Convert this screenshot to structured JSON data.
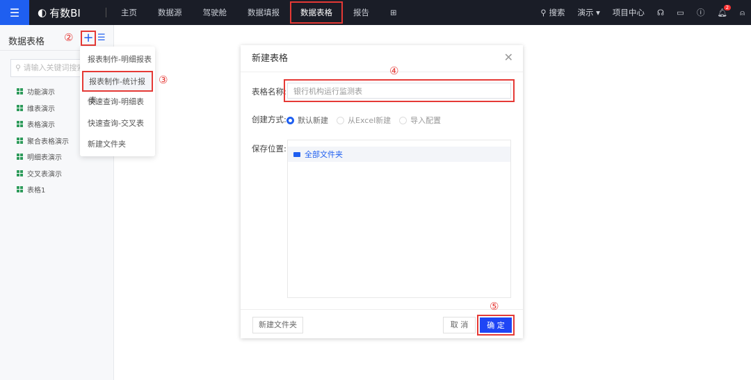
{
  "topbar": {
    "logo": "有数BI",
    "nav": [
      "主页",
      "数据源",
      "驾驶舱",
      "数据填报",
      "数据表格",
      "报告"
    ],
    "active_nav": "数据表格",
    "search": "搜索",
    "workspace": "演示",
    "project_center": "项目中心",
    "notification_count": "2"
  },
  "sidebar": {
    "title": "数据表格",
    "search_placeholder": "请输入关键词搜索",
    "items": [
      "功能演示",
      "维表演示",
      "表格演示",
      "聚合表格演示",
      "明细表演示",
      "交叉表演示",
      "表格1"
    ]
  },
  "dropdown": {
    "items": [
      "报表制作-明细报表",
      "报表制作-统计报表",
      "快速查询-明细表",
      "快速查询-交叉表",
      "新建文件夹"
    ],
    "highlighted": "报表制作-统计报表"
  },
  "dialog": {
    "title": "新建表格",
    "name_label": "表格名称:",
    "name_value": "银行机构运行监测表",
    "method_label": "创建方式:",
    "methods": [
      "默认新建",
      "从Excel新建",
      "导入配置"
    ],
    "selected_method": "默认新建",
    "location_label": "保存位置:",
    "folder": "全部文件夹",
    "new_folder": "新建文件夹",
    "cancel": "取 消",
    "ok": "确 定"
  },
  "annotations": [
    "①",
    "②",
    "③",
    "④",
    "⑤"
  ],
  "colors": {
    "accent": "#1f5ff0",
    "highlight": "#e53935",
    "topbar": "#1a1d27"
  }
}
